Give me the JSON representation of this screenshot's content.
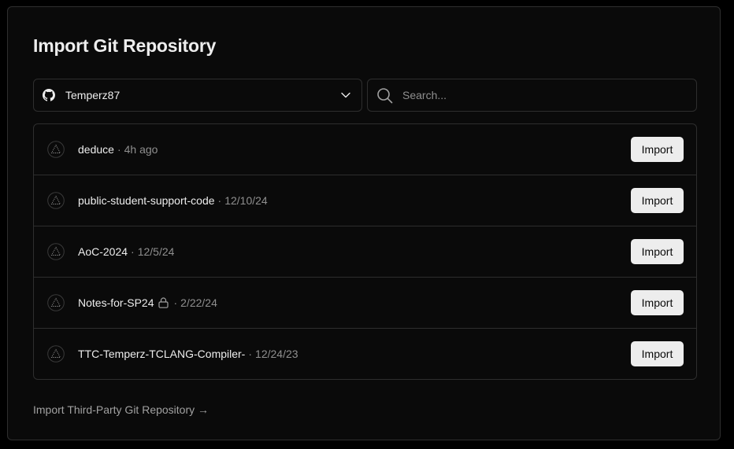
{
  "header": {
    "title": "Import Git Repository"
  },
  "account": {
    "name": "Temperz87"
  },
  "search": {
    "placeholder": "Search..."
  },
  "repos": [
    {
      "name": "deduce",
      "date": "4h ago",
      "private": false,
      "button": "Import"
    },
    {
      "name": "public-student-support-code",
      "date": "12/10/24",
      "private": false,
      "button": "Import"
    },
    {
      "name": "AoC-2024",
      "date": "12/5/24",
      "private": false,
      "button": "Import"
    },
    {
      "name": "Notes-for-SP24",
      "date": "2/22/24",
      "private": true,
      "button": "Import"
    },
    {
      "name": "TTC-Temperz-TCLANG-Compiler-",
      "date": "12/24/23",
      "private": false,
      "button": "Import"
    }
  ],
  "separator": "·",
  "footer": {
    "third_party_link": "Import Third-Party Git Repository →"
  },
  "colors": {
    "background": "#0a0a0a",
    "border": "#2e2e2e",
    "button_bg": "#ededed",
    "muted_text": "#8f8f8f"
  }
}
